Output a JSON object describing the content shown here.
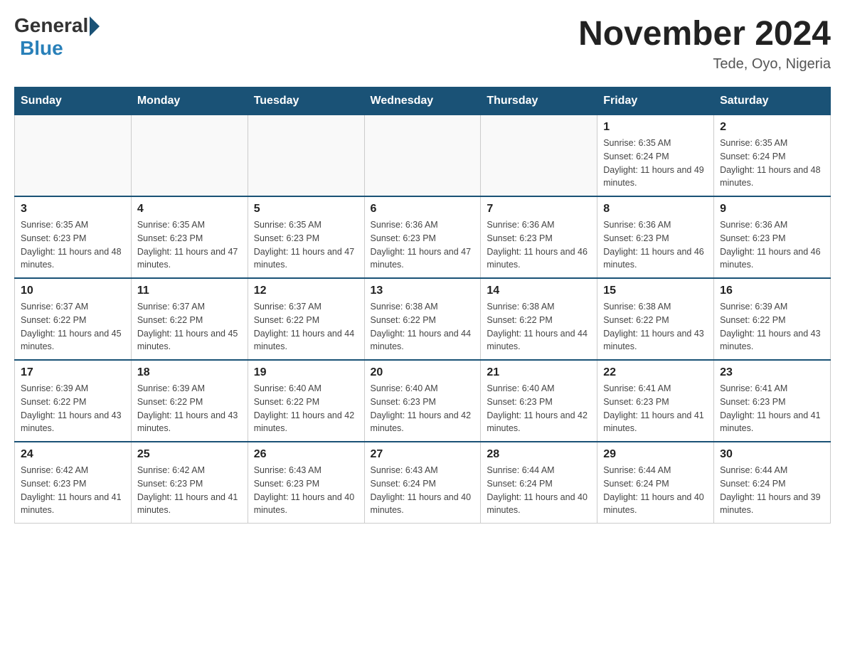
{
  "header": {
    "logo_general": "General",
    "logo_blue": "Blue",
    "month_title": "November 2024",
    "location": "Tede, Oyo, Nigeria"
  },
  "weekdays": [
    "Sunday",
    "Monday",
    "Tuesday",
    "Wednesday",
    "Thursday",
    "Friday",
    "Saturday"
  ],
  "weeks": [
    [
      {
        "day": "",
        "info": ""
      },
      {
        "day": "",
        "info": ""
      },
      {
        "day": "",
        "info": ""
      },
      {
        "day": "",
        "info": ""
      },
      {
        "day": "",
        "info": ""
      },
      {
        "day": "1",
        "info": "Sunrise: 6:35 AM\nSunset: 6:24 PM\nDaylight: 11 hours and 49 minutes."
      },
      {
        "day": "2",
        "info": "Sunrise: 6:35 AM\nSunset: 6:24 PM\nDaylight: 11 hours and 48 minutes."
      }
    ],
    [
      {
        "day": "3",
        "info": "Sunrise: 6:35 AM\nSunset: 6:23 PM\nDaylight: 11 hours and 48 minutes."
      },
      {
        "day": "4",
        "info": "Sunrise: 6:35 AM\nSunset: 6:23 PM\nDaylight: 11 hours and 47 minutes."
      },
      {
        "day": "5",
        "info": "Sunrise: 6:35 AM\nSunset: 6:23 PM\nDaylight: 11 hours and 47 minutes."
      },
      {
        "day": "6",
        "info": "Sunrise: 6:36 AM\nSunset: 6:23 PM\nDaylight: 11 hours and 47 minutes."
      },
      {
        "day": "7",
        "info": "Sunrise: 6:36 AM\nSunset: 6:23 PM\nDaylight: 11 hours and 46 minutes."
      },
      {
        "day": "8",
        "info": "Sunrise: 6:36 AM\nSunset: 6:23 PM\nDaylight: 11 hours and 46 minutes."
      },
      {
        "day": "9",
        "info": "Sunrise: 6:36 AM\nSunset: 6:23 PM\nDaylight: 11 hours and 46 minutes."
      }
    ],
    [
      {
        "day": "10",
        "info": "Sunrise: 6:37 AM\nSunset: 6:22 PM\nDaylight: 11 hours and 45 minutes."
      },
      {
        "day": "11",
        "info": "Sunrise: 6:37 AM\nSunset: 6:22 PM\nDaylight: 11 hours and 45 minutes."
      },
      {
        "day": "12",
        "info": "Sunrise: 6:37 AM\nSunset: 6:22 PM\nDaylight: 11 hours and 44 minutes."
      },
      {
        "day": "13",
        "info": "Sunrise: 6:38 AM\nSunset: 6:22 PM\nDaylight: 11 hours and 44 minutes."
      },
      {
        "day": "14",
        "info": "Sunrise: 6:38 AM\nSunset: 6:22 PM\nDaylight: 11 hours and 44 minutes."
      },
      {
        "day": "15",
        "info": "Sunrise: 6:38 AM\nSunset: 6:22 PM\nDaylight: 11 hours and 43 minutes."
      },
      {
        "day": "16",
        "info": "Sunrise: 6:39 AM\nSunset: 6:22 PM\nDaylight: 11 hours and 43 minutes."
      }
    ],
    [
      {
        "day": "17",
        "info": "Sunrise: 6:39 AM\nSunset: 6:22 PM\nDaylight: 11 hours and 43 minutes."
      },
      {
        "day": "18",
        "info": "Sunrise: 6:39 AM\nSunset: 6:22 PM\nDaylight: 11 hours and 43 minutes."
      },
      {
        "day": "19",
        "info": "Sunrise: 6:40 AM\nSunset: 6:22 PM\nDaylight: 11 hours and 42 minutes."
      },
      {
        "day": "20",
        "info": "Sunrise: 6:40 AM\nSunset: 6:23 PM\nDaylight: 11 hours and 42 minutes."
      },
      {
        "day": "21",
        "info": "Sunrise: 6:40 AM\nSunset: 6:23 PM\nDaylight: 11 hours and 42 minutes."
      },
      {
        "day": "22",
        "info": "Sunrise: 6:41 AM\nSunset: 6:23 PM\nDaylight: 11 hours and 41 minutes."
      },
      {
        "day": "23",
        "info": "Sunrise: 6:41 AM\nSunset: 6:23 PM\nDaylight: 11 hours and 41 minutes."
      }
    ],
    [
      {
        "day": "24",
        "info": "Sunrise: 6:42 AM\nSunset: 6:23 PM\nDaylight: 11 hours and 41 minutes."
      },
      {
        "day": "25",
        "info": "Sunrise: 6:42 AM\nSunset: 6:23 PM\nDaylight: 11 hours and 41 minutes."
      },
      {
        "day": "26",
        "info": "Sunrise: 6:43 AM\nSunset: 6:23 PM\nDaylight: 11 hours and 40 minutes."
      },
      {
        "day": "27",
        "info": "Sunrise: 6:43 AM\nSunset: 6:24 PM\nDaylight: 11 hours and 40 minutes."
      },
      {
        "day": "28",
        "info": "Sunrise: 6:44 AM\nSunset: 6:24 PM\nDaylight: 11 hours and 40 minutes."
      },
      {
        "day": "29",
        "info": "Sunrise: 6:44 AM\nSunset: 6:24 PM\nDaylight: 11 hours and 40 minutes."
      },
      {
        "day": "30",
        "info": "Sunrise: 6:44 AM\nSunset: 6:24 PM\nDaylight: 11 hours and 39 minutes."
      }
    ]
  ]
}
